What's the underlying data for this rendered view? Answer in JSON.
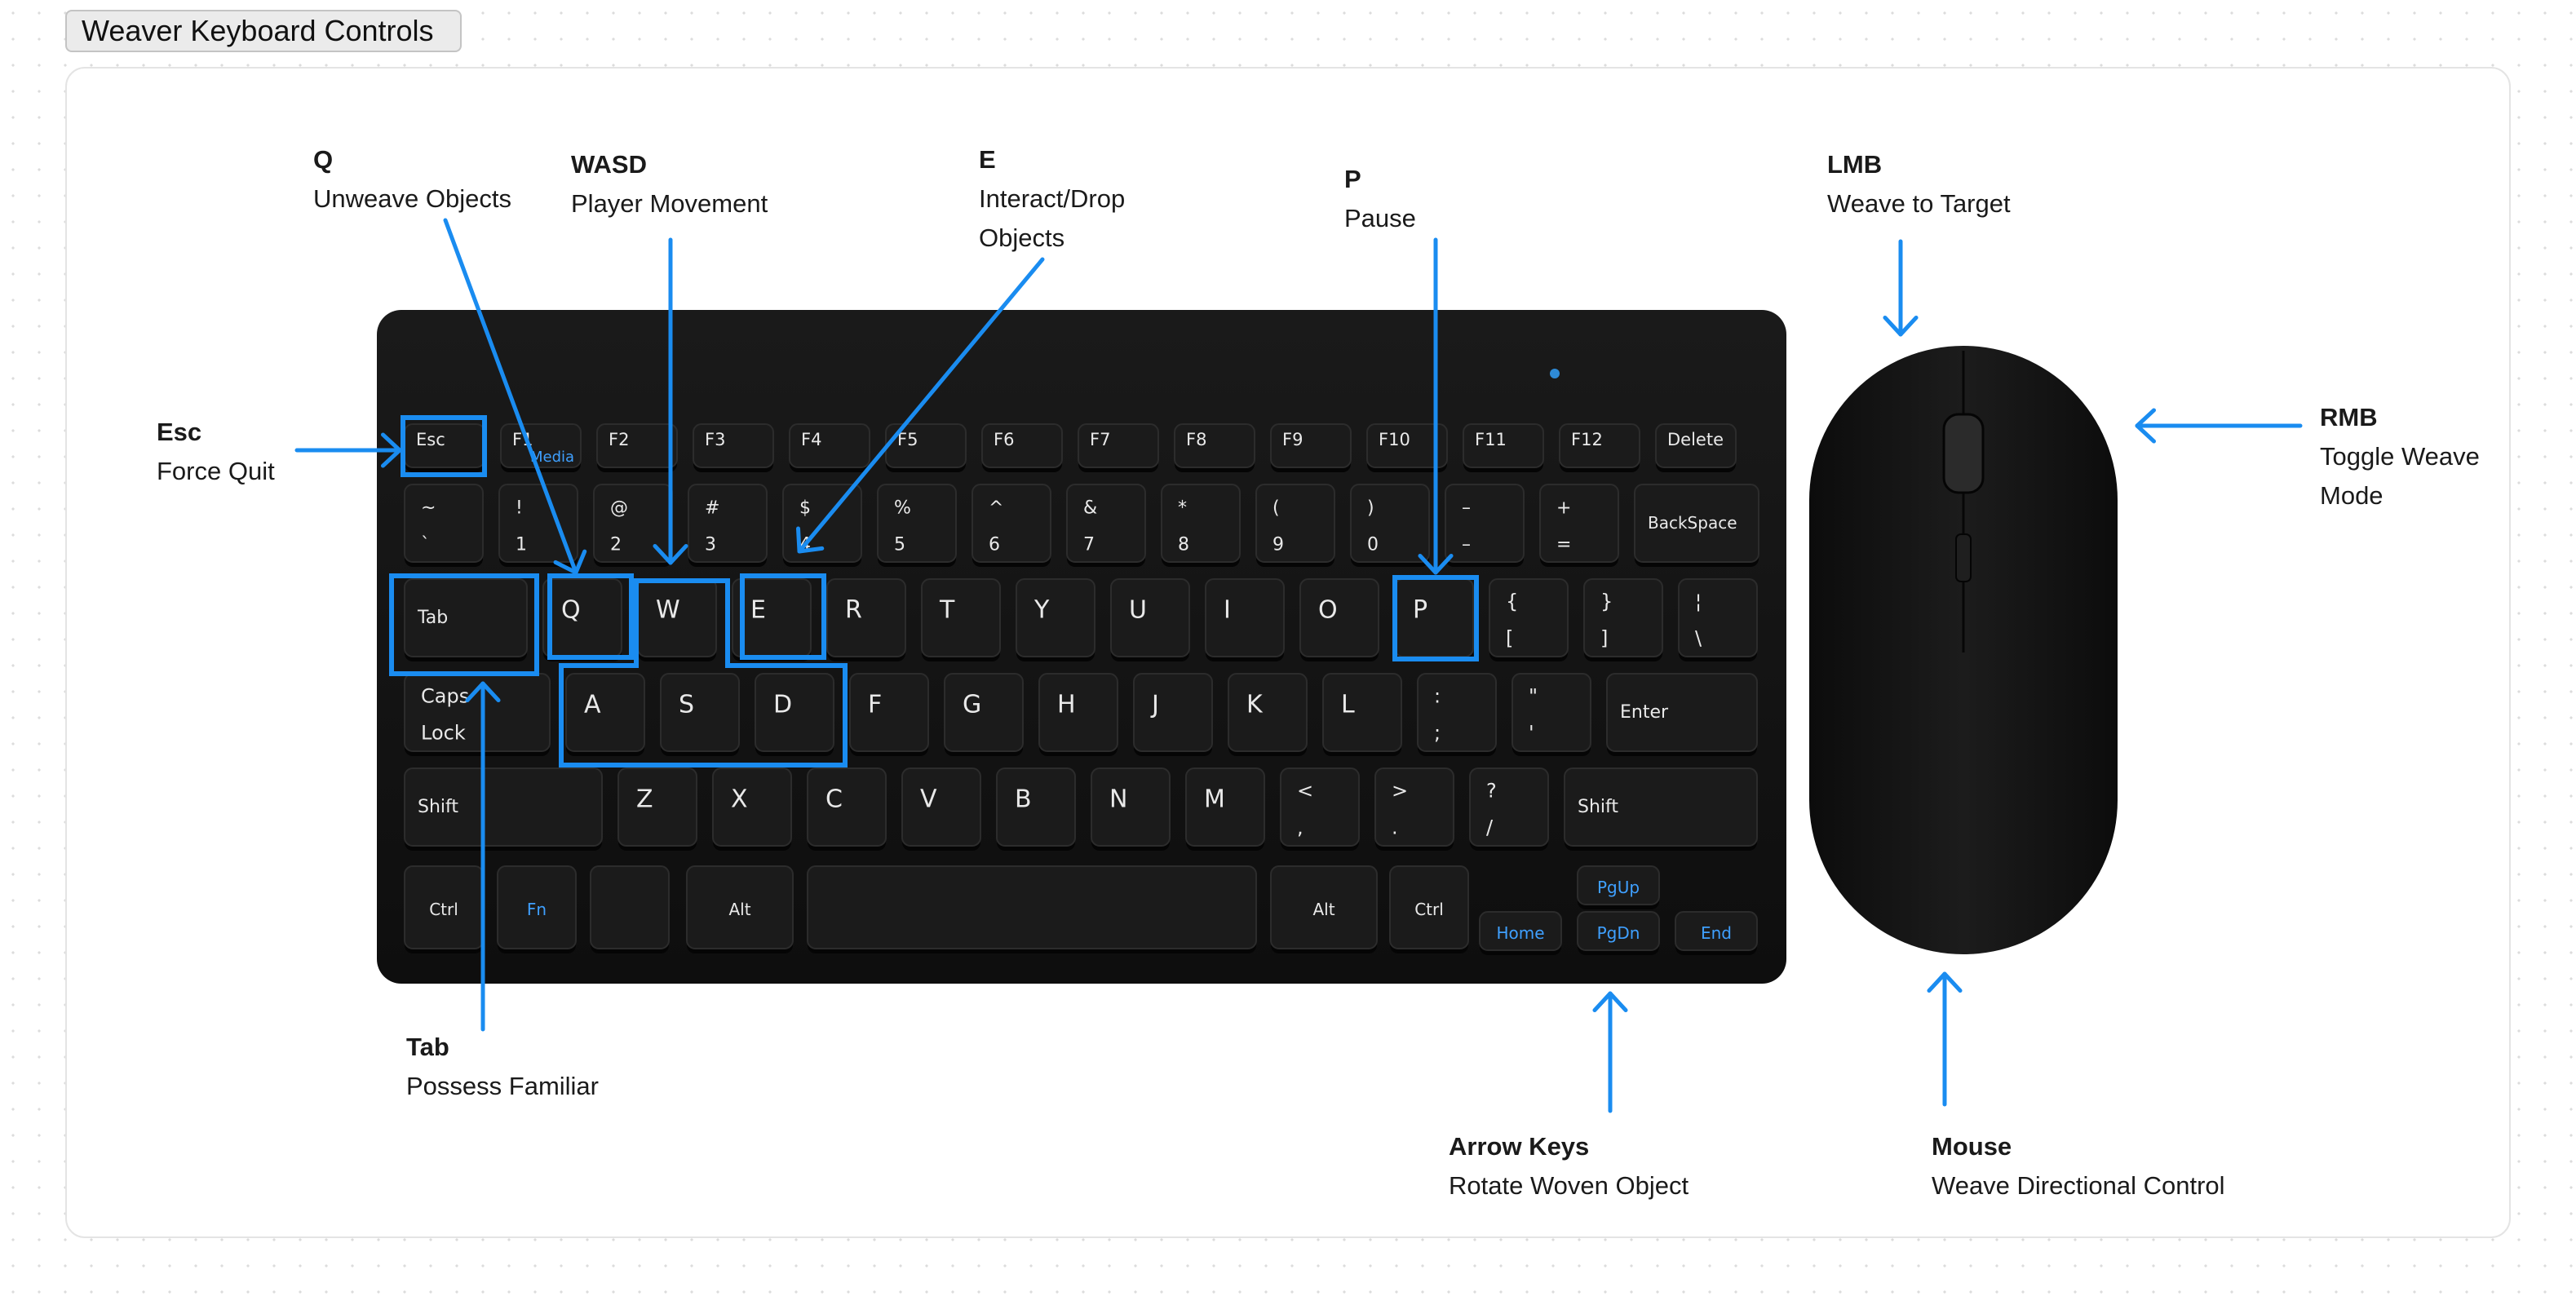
{
  "title": "Weaver Keyboard Controls",
  "accent_color": "#1a8cf0",
  "key_face_color": "#1b1b1b",
  "callouts": {
    "q": {
      "key": "Q",
      "desc": "Unweave Objects"
    },
    "wasd": {
      "key": "WASD",
      "desc": "Player Movement"
    },
    "e": {
      "key": "E",
      "desc": "Interact/Drop Objects"
    },
    "p": {
      "key": "P",
      "desc": "Pause"
    },
    "lmb": {
      "key": "LMB",
      "desc": "Weave to Target"
    },
    "esc": {
      "key": "Esc",
      "desc": "Force Quit"
    },
    "rmb": {
      "key": "RMB",
      "desc": "Toggle Weave Mode"
    },
    "tab": {
      "key": "Tab",
      "desc": "Possess Familiar"
    },
    "arrows": {
      "key": "Arrow Keys",
      "desc": "Rotate Woven Object"
    },
    "mouse": {
      "key": "Mouse",
      "desc": "Weave Directional Control"
    }
  },
  "keyboard": {
    "fn_row": [
      {
        "top": "Esc"
      },
      {
        "top": "F1",
        "bottom": "Media"
      },
      {
        "top": "F2"
      },
      {
        "top": "F3"
      },
      {
        "top": "F4"
      },
      {
        "top": "F5"
      },
      {
        "top": "F6"
      },
      {
        "top": "F7"
      },
      {
        "top": "F8"
      },
      {
        "top": "F9"
      },
      {
        "top": "F10"
      },
      {
        "top": "F11"
      },
      {
        "top": "F12"
      },
      {
        "top": "Delete"
      }
    ],
    "number_row": [
      {
        "top": "~",
        "bottom": "`"
      },
      {
        "top": "!",
        "bottom": "1"
      },
      {
        "top": "@",
        "bottom": "2"
      },
      {
        "top": "#",
        "bottom": "3"
      },
      {
        "top": "$",
        "bottom": "4"
      },
      {
        "top": "%",
        "bottom": "5"
      },
      {
        "top": "^",
        "bottom": "6"
      },
      {
        "top": "&",
        "bottom": "7"
      },
      {
        "top": "*",
        "bottom": "8"
      },
      {
        "top": "(",
        "bottom": "9"
      },
      {
        "top": ")",
        "bottom": "0"
      },
      {
        "top": "–",
        "bottom": "–"
      },
      {
        "top": "+",
        "bottom": "="
      },
      {
        "top": "BackSpace"
      }
    ],
    "top_row": [
      {
        "top": "Tab"
      },
      {
        "top": "Q"
      },
      {
        "top": "W"
      },
      {
        "top": "E"
      },
      {
        "top": "R"
      },
      {
        "top": "T"
      },
      {
        "top": "Y"
      },
      {
        "top": "U"
      },
      {
        "top": "I"
      },
      {
        "top": "O"
      },
      {
        "top": "P"
      },
      {
        "top": "{",
        "bottom": "["
      },
      {
        "top": "}",
        "bottom": "]"
      },
      {
        "top": "¦",
        "bottom": "\\"
      }
    ],
    "home_row": [
      {
        "top": "Caps",
        "bottom": "Lock"
      },
      {
        "top": "A"
      },
      {
        "top": "S"
      },
      {
        "top": "D"
      },
      {
        "top": "F"
      },
      {
        "top": "G"
      },
      {
        "top": "H"
      },
      {
        "top": "J"
      },
      {
        "top": "K"
      },
      {
        "top": "L"
      },
      {
        "top": ":",
        "bottom": ";"
      },
      {
        "top": "\"",
        "bottom": "'"
      },
      {
        "top": "Enter"
      }
    ],
    "shift_row": [
      {
        "top": "Shift"
      },
      {
        "top": "Z"
      },
      {
        "top": "X"
      },
      {
        "top": "C"
      },
      {
        "top": "V"
      },
      {
        "top": "B"
      },
      {
        "top": "N"
      },
      {
        "top": "M"
      },
      {
        "top": "<",
        "bottom": ","
      },
      {
        "top": ">",
        "bottom": "."
      },
      {
        "top": "?",
        "bottom": "/"
      },
      {
        "top": "Shift"
      }
    ],
    "bottom_row": [
      {
        "top": "Ctrl"
      },
      {
        "top": "Fn"
      },
      {
        "top": ""
      },
      {
        "top": "Alt"
      },
      {
        "top": ""
      },
      {
        "top": "Alt"
      },
      {
        "top": "Ctrl"
      },
      {
        "top": "Home"
      },
      {
        "top": "PgUp"
      },
      {
        "top": "PgDn"
      },
      {
        "top": "End"
      }
    ]
  }
}
